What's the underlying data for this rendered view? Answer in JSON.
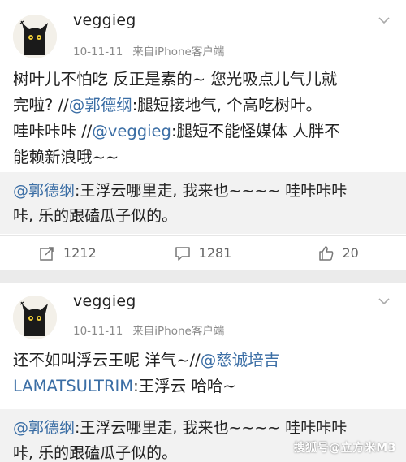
{
  "posts": [
    {
      "username": "veggieg",
      "date": "10-11-11",
      "source": "来自iPhone客户端",
      "body_lines": [
        {
          "parts": [
            {
              "text": "树叶儿不怕吃 反正是素的~ 您光吸点儿气儿就",
              "mention": false
            }
          ]
        },
        {
          "parts": [
            {
              "text": "完啦? //",
              "mention": false
            },
            {
              "text": "@郭德纲",
              "mention": true
            },
            {
              "text": ":腿短接地气, 个高吃树叶。",
              "mention": false
            }
          ]
        },
        {
          "parts": [
            {
              "text": "哇咔咔咔 //",
              "mention": false
            },
            {
              "text": "@veggieg",
              "mention": true
            },
            {
              "text": ":腿短不能怪媒体 人胖不",
              "mention": false
            }
          ]
        },
        {
          "parts": [
            {
              "text": "能赖新浪哦~~",
              "mention": false
            }
          ]
        }
      ],
      "quote": {
        "author": "@郭德纲",
        "line1": ":王浮云哪里走, 我来也~~~~ 哇咔咔咔",
        "line2": "咔, 乐的跟磕瓜子似的。"
      },
      "actions": {
        "repost_count": "1212",
        "comment_count": "1281",
        "like_count": "20"
      }
    },
    {
      "username": "veggieg",
      "date": "10-11-11",
      "source": "来自iPhone客户端",
      "body_lines": [
        {
          "parts": [
            {
              "text": "还不如叫浮云王呢 洋气~//",
              "mention": false
            },
            {
              "text": "@慈诚培吉",
              "mention": true
            }
          ]
        },
        {
          "parts": [
            {
              "text": "LAMATSULTRIM",
              "mention": true
            },
            {
              "text": ":王浮云 哈哈~",
              "mention": false
            }
          ]
        }
      ],
      "quote": {
        "author": "@郭德纲",
        "line1": ":王浮云哪里走, 我来也~~~~ 哇咔咔咔",
        "line2": "咔, 乐的跟磕瓜子似的。"
      }
    }
  ],
  "watermark": "搜狐号@立方米M3",
  "colors": {
    "mention": "#3b6ea5",
    "meta": "#8a8a8a",
    "quote_bg": "#f2f2f2",
    "page_bg": "#ebebeb"
  },
  "icons": {
    "avatar": "black-cat-avatar-icon",
    "menu": "chevron-down-icon",
    "repost": "repost-icon",
    "comment": "comment-icon",
    "like": "thumbs-up-icon"
  }
}
